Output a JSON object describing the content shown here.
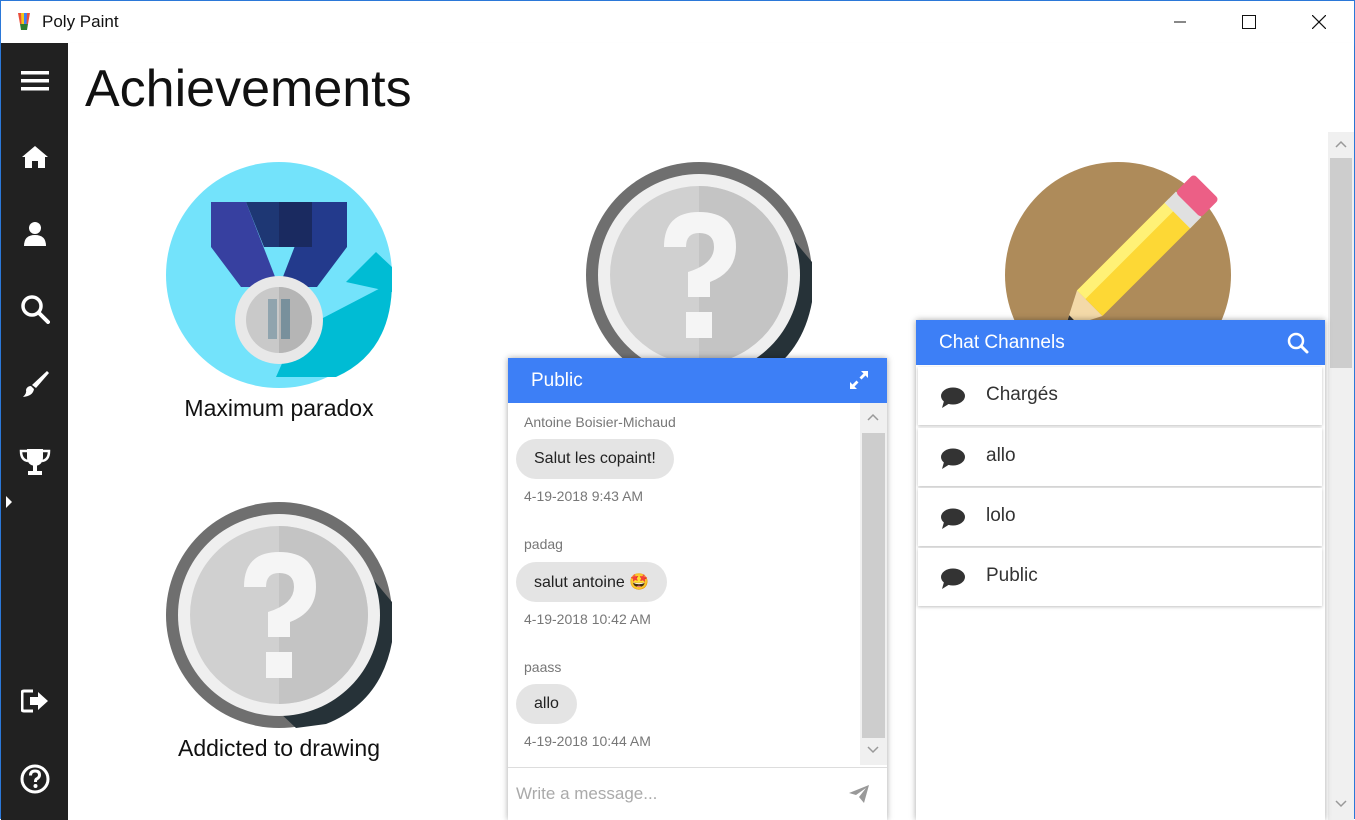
{
  "window": {
    "title": "Poly Paint",
    "controls": {
      "minimize": "minimize",
      "maximize": "maximize",
      "close": "close"
    }
  },
  "sidebar": {
    "items": [
      {
        "id": "menu",
        "icon": "hamburger-icon"
      },
      {
        "id": "home",
        "icon": "home-icon"
      },
      {
        "id": "profile",
        "icon": "user-icon"
      },
      {
        "id": "search",
        "icon": "search-icon"
      },
      {
        "id": "draw",
        "icon": "paintbrush-icon"
      },
      {
        "id": "achievements",
        "icon": "trophy-icon",
        "active": true
      },
      {
        "id": "logout",
        "icon": "logout-icon"
      },
      {
        "id": "help",
        "icon": "help-icon"
      }
    ]
  },
  "header": {
    "title": "Achievements"
  },
  "achievements": [
    {
      "label": "Maximum paradox",
      "icon": "medal-icon",
      "unlocked": true
    },
    {
      "label": "",
      "icon": "question-icon",
      "unlocked": false
    },
    {
      "label": "",
      "icon": "pencil-icon",
      "unlocked": true
    },
    {
      "label": "Addicted to drawing",
      "icon": "question-icon",
      "unlocked": false
    }
  ],
  "chat": {
    "channel": "Public",
    "messages": [
      {
        "author": "Antoine Boisier-Michaud",
        "text": "Salut les copaint!",
        "time": "4-19-2018 9:43 AM"
      },
      {
        "author": "padag",
        "text": "salut antoine 🤩",
        "time": "4-19-2018 10:42 AM"
      },
      {
        "author": "paass",
        "text": "allo",
        "time": "4-19-2018 10:44 AM"
      }
    ],
    "input_placeholder": "Write a message..."
  },
  "channels": {
    "title": "Chat Channels",
    "items": [
      "Chargés",
      "allo",
      "lolo",
      "Public"
    ]
  },
  "colors": {
    "accent": "#3d7ff6",
    "sidebar": "#212121",
    "bubble": "#e4e4e4"
  }
}
